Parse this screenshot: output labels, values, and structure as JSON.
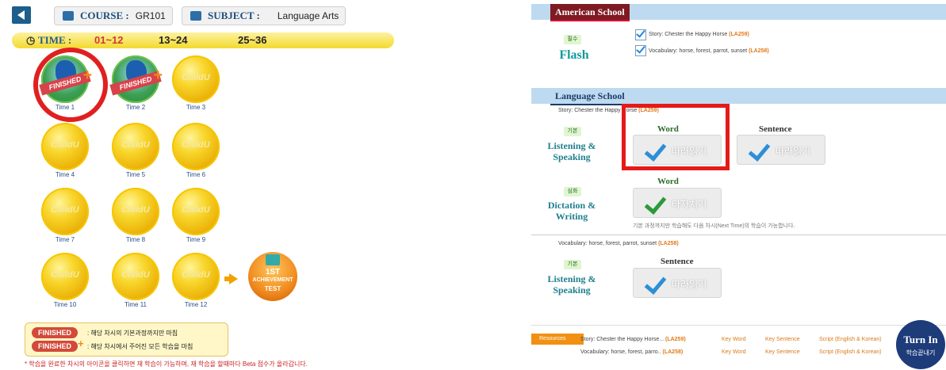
{
  "header": {
    "course_label": "COURSE :",
    "course_value": "GR101",
    "subject_label": "SUBJECT :",
    "subject_value": "Language Arts"
  },
  "time_bar": {
    "label": "TIME :",
    "ranges": [
      "01~12",
      "13~24",
      "25~36"
    ],
    "active_range": "01~12"
  },
  "coins": [
    {
      "label": "Time 1",
      "state": "finished",
      "coin_text": ""
    },
    {
      "label": "Time 2",
      "state": "finished",
      "coin_text": ""
    },
    {
      "label": "Time 3",
      "state": "locked",
      "coin_text": "ChildU"
    },
    {
      "label": "Time 4",
      "state": "locked",
      "coin_text": "ChildU"
    },
    {
      "label": "Time 5",
      "state": "locked",
      "coin_text": "ChildU"
    },
    {
      "label": "Time 6",
      "state": "locked",
      "coin_text": "ChildU"
    },
    {
      "label": "Time 7",
      "state": "locked",
      "coin_text": "ChildU"
    },
    {
      "label": "Time 8",
      "state": "locked",
      "coin_text": "ChildU"
    },
    {
      "label": "Time 9",
      "state": "locked",
      "coin_text": "ChildU"
    },
    {
      "label": "Time 10",
      "state": "locked",
      "coin_text": "ChildU"
    },
    {
      "label": "Time 11",
      "state": "locked",
      "coin_text": "ChildU"
    },
    {
      "label": "Time 12",
      "state": "locked",
      "coin_text": "ChildU"
    }
  ],
  "finished_ribbon": "FINISHED",
  "achievement": {
    "line1": "1ST",
    "line2": "ACHIEVEMENT",
    "line3": "TEST"
  },
  "legend": {
    "finished_tag": "FINISHED",
    "finished_text": ": 해당 차시의 기본과정까지만 마침",
    "finished_plus_tag": "FINISHED",
    "finished_plus_text": ": 해당 차시에서 주어진 모든 학습을 마침"
  },
  "footnote": "* 학습을 완료한 차시의 아이콘을 클릭하면 재 학습이 가능하며, 재 학습을 할때마다 Beta 점수가 올라갑니다.",
  "right": {
    "american_school": {
      "title": "American School",
      "badge": "필수",
      "category": "Flash",
      "items": [
        {
          "text": "Story: Chester the Happy Horse",
          "code": "(LA259)"
        },
        {
          "text": "Vocabulary: horse, forest, parrot, sunset",
          "code": "(LA258)"
        }
      ]
    },
    "language_school": {
      "title": "Language School",
      "story_line": "Story: Chester the Happy Horse",
      "story_code": "(LA259)",
      "listening1": {
        "badge": "기본",
        "category_line1": "Listening &",
        "category_line2": "Speaking",
        "word_header": "Word",
        "sentence_header": "Sentence",
        "word_button": "따라읽기",
        "sentence_button": "따라읽기"
      },
      "dictation": {
        "badge": "심화",
        "category_line1": "Dictation &",
        "category_line2": "Writing",
        "word_header": "Word",
        "button": "타자치기",
        "note": "기본 과정까지만 학습해도 다음 차시(Next Time)의 학습이 가능합니다."
      },
      "vocab_line": "Vocabulary: horse, forest, parrot, sunset",
      "vocab_code": "(LA258)",
      "listening2": {
        "badge": "기본",
        "category_line1": "Listening &",
        "category_line2": "Speaking",
        "sentence_header": "Sentence",
        "button": "따라읽기"
      }
    },
    "resources": {
      "tag": "Resources",
      "rows": [
        {
          "text": "Story: Chester the Happy Horse...",
          "code": "(LA259)"
        },
        {
          "text": "Vocabulary: horse, forest, parro..",
          "code": "(LA258)"
        }
      ],
      "links": [
        "Key Word",
        "Key Sentence",
        "Script (English & Korean)"
      ]
    },
    "turn_in": {
      "line1": "Turn In",
      "line2": "학습끝내기"
    }
  }
}
